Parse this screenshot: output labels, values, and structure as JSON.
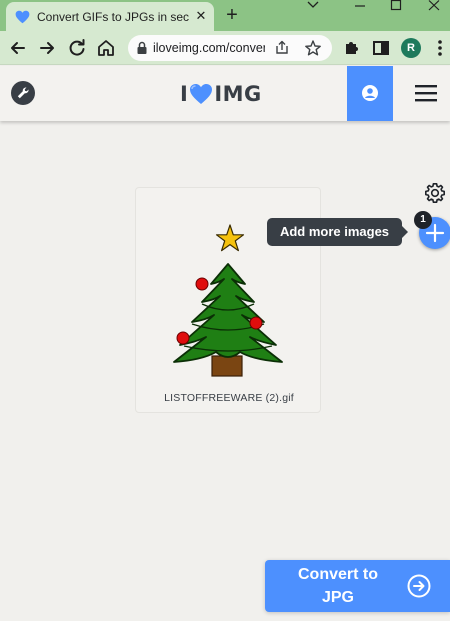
{
  "browser": {
    "tab_title": "Convert GIFs to JPGs in seconds",
    "tab_close": "✕",
    "new_tab": "+",
    "url": "iloveimg.com/convert-to-jpg/gif-to-jpg",
    "profile_initial": "R",
    "icons": [
      "heart-favicon",
      "back-arrow",
      "forward-arrow",
      "reload",
      "home",
      "lock",
      "share",
      "star",
      "extensions-puzzle",
      "side-panel",
      "kebab-menu",
      "minimize",
      "maximize",
      "close",
      "chevron-down"
    ]
  },
  "site": {
    "logo_left": "I",
    "logo_right": "IMG",
    "brand_color": "#4d90fe",
    "dark_color": "#383e45",
    "header_icons": [
      "wrench-icon",
      "user-icon",
      "hamburger-menu-icon"
    ]
  },
  "workspace": {
    "file_name": "LISTOFFREEWARE (2).gif",
    "tooltip": "Add more images",
    "file_count": "1",
    "convert_label": "Convert to JPG",
    "icons": [
      "settings-gear-icon",
      "plus-icon",
      "arrow-right-circle-icon"
    ]
  }
}
